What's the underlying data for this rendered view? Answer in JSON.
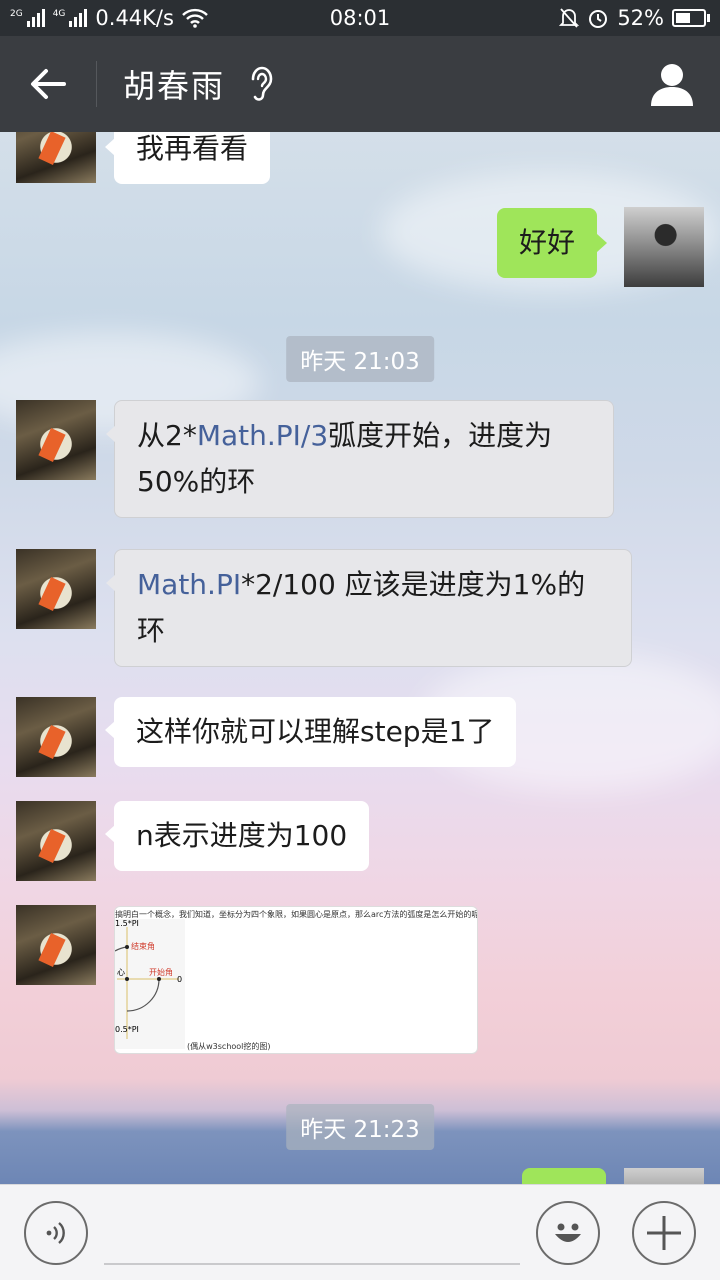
{
  "status_bar": {
    "network_left": "2G",
    "network_right": "4G",
    "speed": "0.44K/s",
    "time": "08:01",
    "battery": "52%",
    "battery_level": 0.52,
    "icons": [
      "signal-icon",
      "wifi-icon",
      "mute-icon",
      "alarm-icon",
      "battery-icon"
    ]
  },
  "header": {
    "title": "胡春雨",
    "back_icon": "arrow-left-icon",
    "ear_icon": "earpiece-icon",
    "profile_icon": "person-icon"
  },
  "messages": {
    "m0": "我再看看",
    "m1": "好好",
    "ts1": "昨天 21:03",
    "m2_a": "从2*",
    "m2_link": "Math.PI/3",
    "m2_b": "弧度开始，进度为50%的环",
    "m3_link": "Math.PI",
    "m3_b": "*2/100 应该是进度为1%的环",
    "m4": "这样你就可以理解step是1了",
    "m5": "n表示进度为100",
    "ts2": "昨天 21:23"
  },
  "image_message": {
    "caption_top": "搞明白一个概念，我们知道，坐标分为四个象限，如果圆心是原点，那么arc方法的弧度是怎么开始的呢",
    "label_15pi": "1.5*PI",
    "label_end": "结束角",
    "label_center": "心",
    "label_start": "开始角",
    "label_zero": "0",
    "label_05pi": "0.5*PI",
    "caption_bottom": "(偶从w3school挖的图)"
  },
  "input_bar": {
    "voice_icon": "voice-icon",
    "emoji_icon": "emoji-icon",
    "plus_icon": "plus-icon"
  },
  "colors": {
    "header_bg": "#3a3d41",
    "status_bg": "#2b2f33",
    "green_bubble": "#9fe55a",
    "link": "#45619a"
  }
}
